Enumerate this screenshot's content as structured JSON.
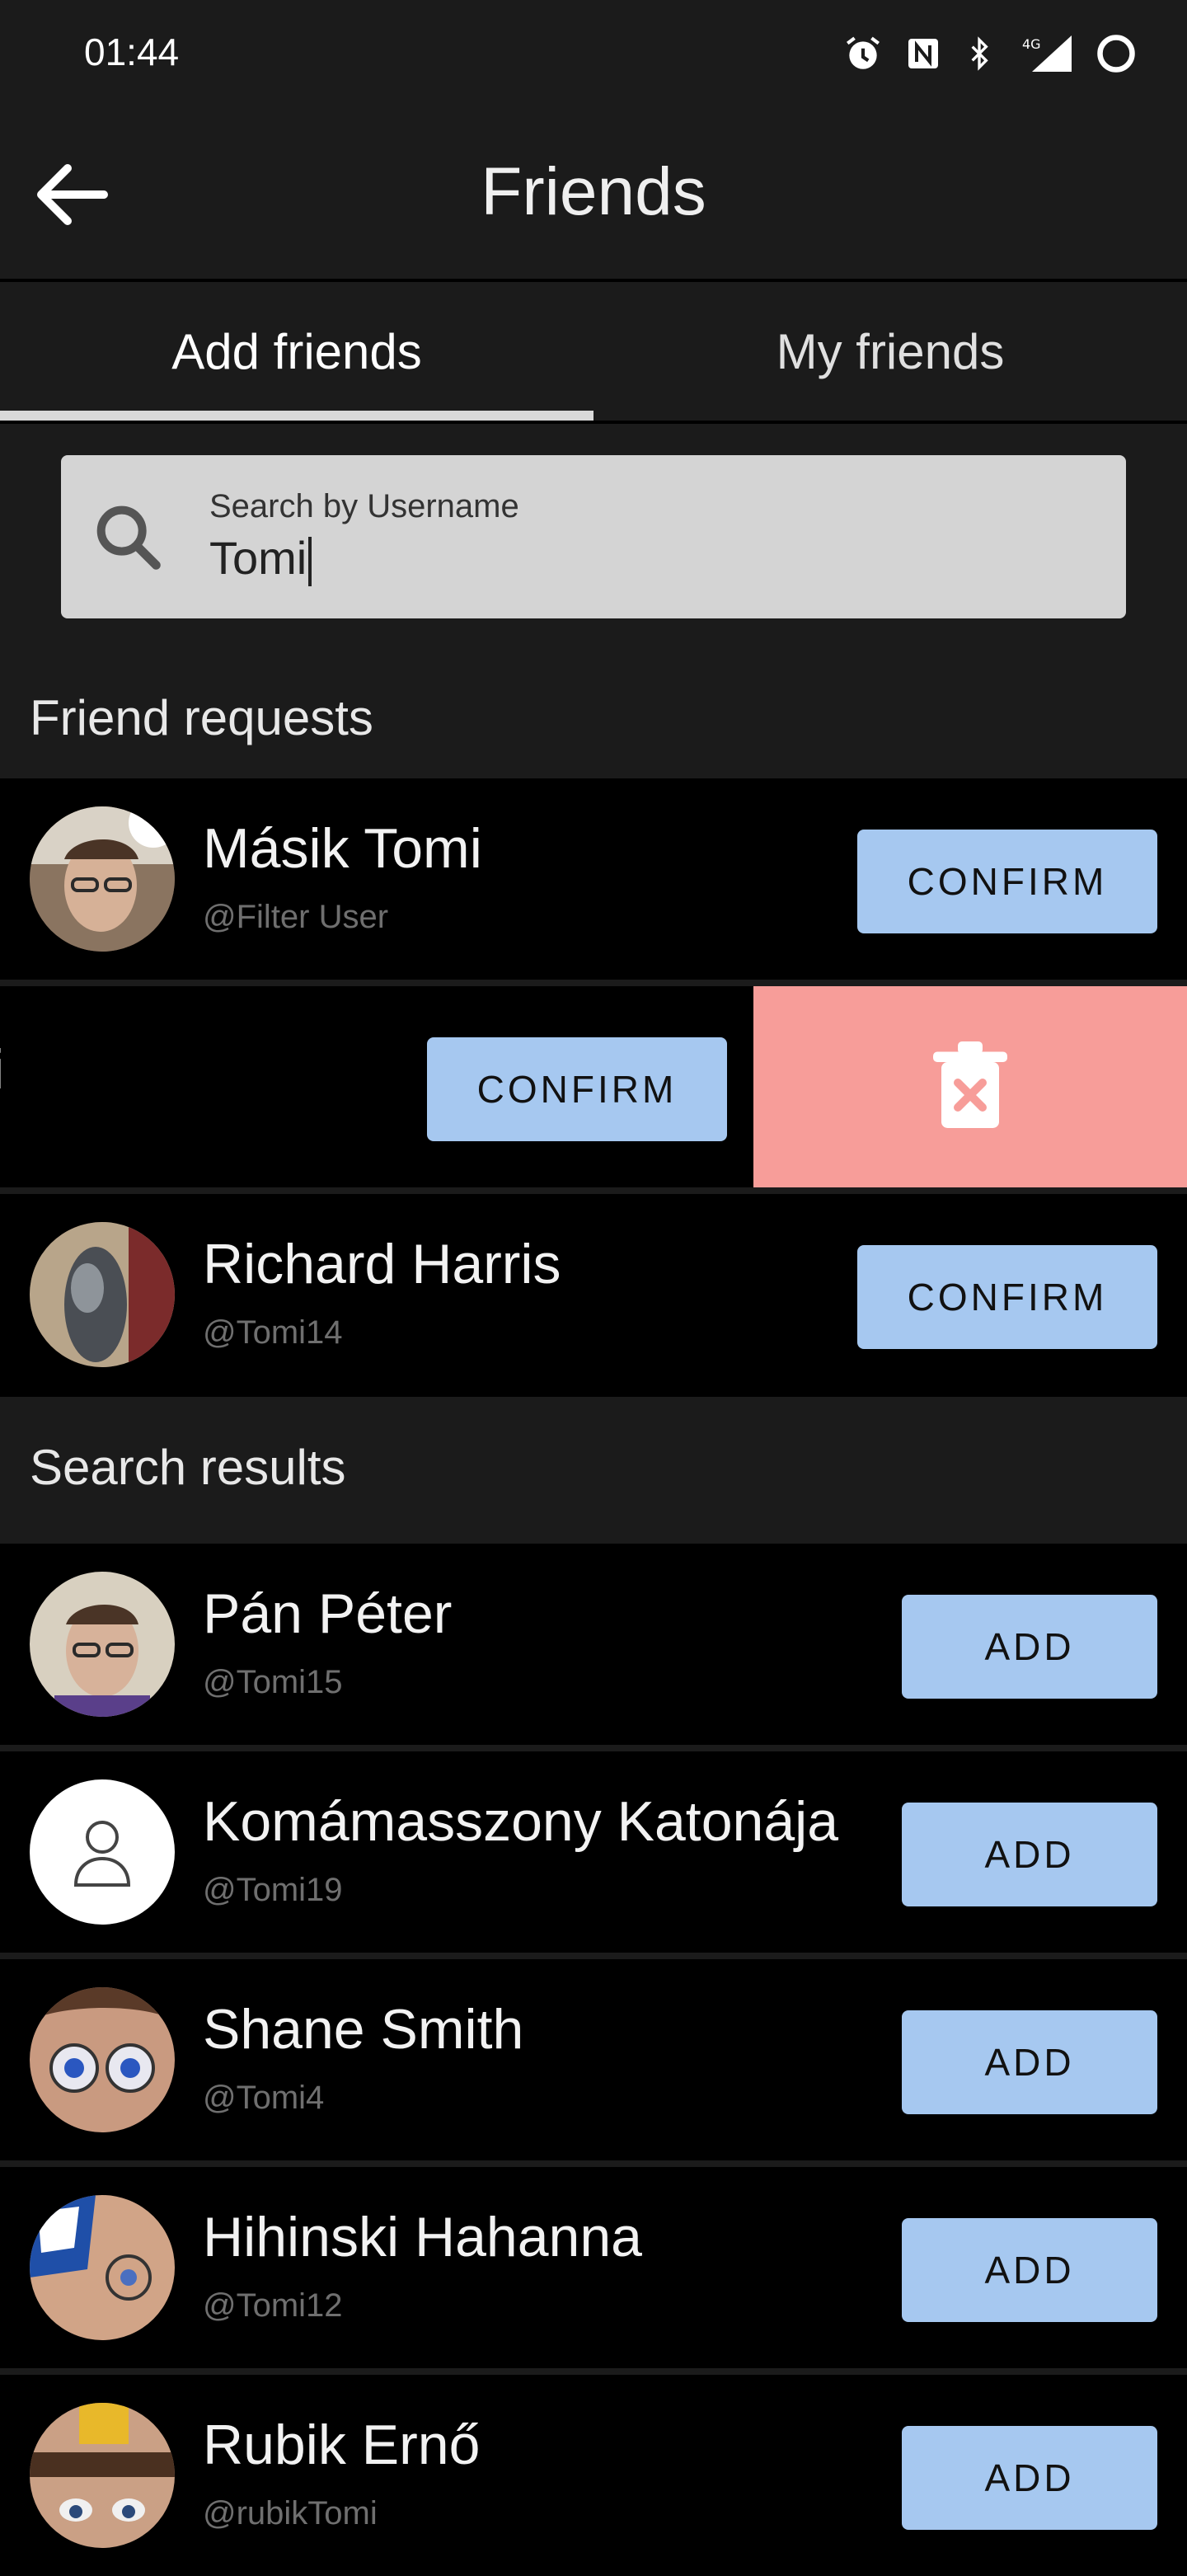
{
  "status_bar": {
    "time": "01:44"
  },
  "app_bar": {
    "title": "Friends"
  },
  "tabs": [
    {
      "label": "Add friends",
      "active": true
    },
    {
      "label": "My friends",
      "active": false
    }
  ],
  "search": {
    "label": "Search by Username",
    "value": "Tomi"
  },
  "friend_requests": {
    "title": "Friend requests",
    "items": [
      {
        "name": "Másik Tomi",
        "handle": "@Filter User",
        "button": "CONFIRM"
      },
      {
        "name_partial": "i",
        "button": "CONFIRM",
        "swiped": true
      },
      {
        "name": "Richard Harris",
        "handle": "@Tomi14",
        "button": "CONFIRM"
      }
    ]
  },
  "search_results": {
    "title": "Search results",
    "items": [
      {
        "name": "Pán Péter",
        "handle": "@Tomi15",
        "button": "ADD"
      },
      {
        "name": "Komámasszony Katonája",
        "handle": "@Tomi19",
        "button": "ADD"
      },
      {
        "name": "Shane Smith",
        "handle": "@Tomi4",
        "button": "ADD"
      },
      {
        "name": "Hihinski Hahanna",
        "handle": "@Tomi12",
        "button": "ADD"
      },
      {
        "name": "Rubik Ernő",
        "handle": "@rubikTomi",
        "button": "ADD"
      }
    ]
  },
  "colors": {
    "background": "#000000",
    "surface": "#1b1b1b",
    "button": "#a6c8f0",
    "delete": "#f79d99"
  }
}
